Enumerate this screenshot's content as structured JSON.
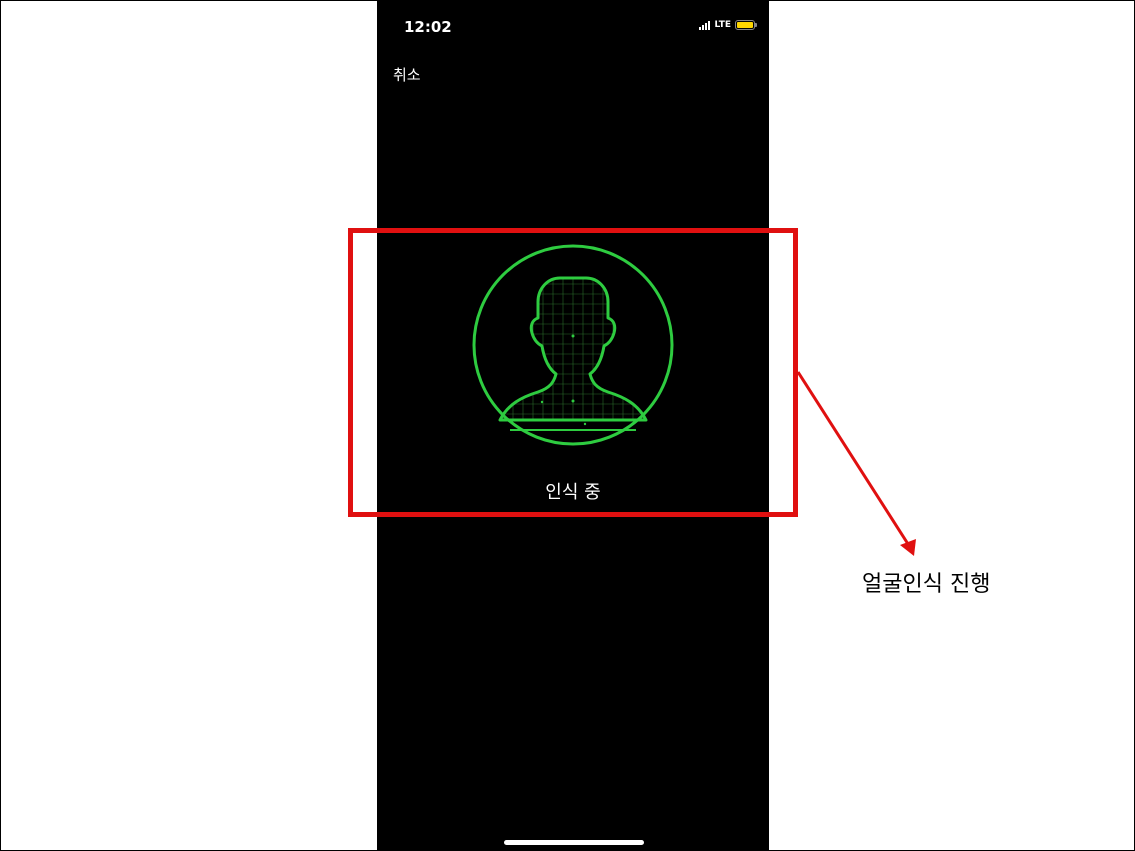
{
  "status_bar": {
    "time": "12:02",
    "network": "LTE",
    "battery_color": "#ffd600"
  },
  "nav": {
    "cancel_label": "취소"
  },
  "recognition": {
    "status_text": "인식 중",
    "graphic_icon": "face-scan-icon",
    "accent_color": "#2ecc40"
  },
  "annotation": {
    "label": "얼굴인식 진행",
    "color": "#e01010"
  }
}
